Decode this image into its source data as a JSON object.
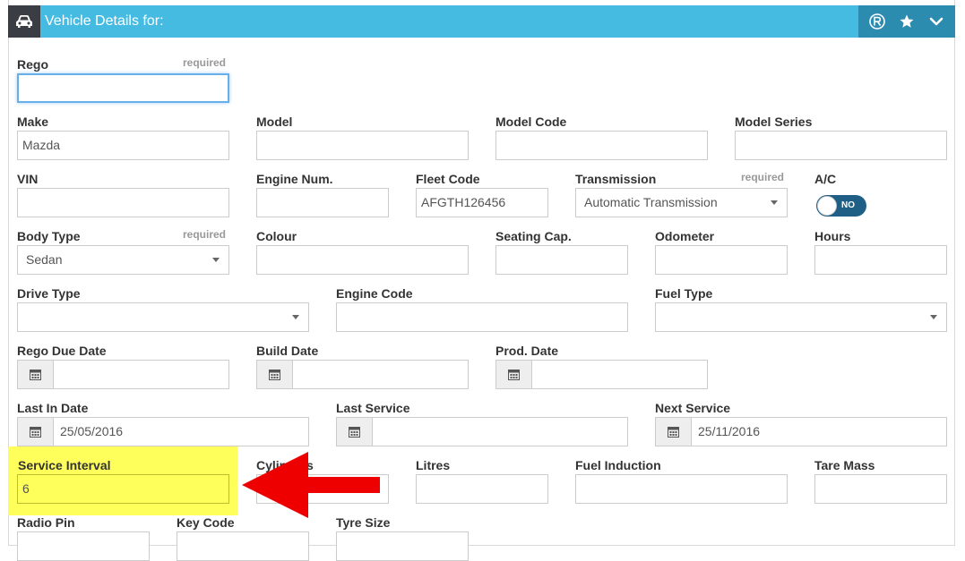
{
  "header": {
    "title": "Vehicle Details for:",
    "icons": [
      "car-icon",
      "r-circle-icon",
      "star-icon",
      "chevron-down-icon"
    ]
  },
  "form": {
    "rego": {
      "label": "Rego",
      "required": "required",
      "value": ""
    },
    "make": {
      "label": "Make",
      "value": "Mazda"
    },
    "model": {
      "label": "Model",
      "value": ""
    },
    "model_code": {
      "label": "Model Code",
      "value": ""
    },
    "model_series": {
      "label": "Model Series",
      "value": ""
    },
    "vin": {
      "label": "VIN",
      "value": ""
    },
    "engine_num": {
      "label": "Engine Num.",
      "value": ""
    },
    "fleet_code": {
      "label": "Fleet Code",
      "value": "AFGTH126456"
    },
    "transmission": {
      "label": "Transmission",
      "required": "required",
      "value": "Automatic Transmission"
    },
    "ac": {
      "label": "A/C",
      "state": "NO"
    },
    "body_type": {
      "label": "Body Type",
      "required": "required",
      "value": "Sedan"
    },
    "colour": {
      "label": "Colour",
      "value": ""
    },
    "seating_cap": {
      "label": "Seating Cap.",
      "value": ""
    },
    "odometer": {
      "label": "Odometer",
      "value": ""
    },
    "hours": {
      "label": "Hours",
      "value": ""
    },
    "drive_type": {
      "label": "Drive Type",
      "value": ""
    },
    "engine_code": {
      "label": "Engine Code",
      "value": ""
    },
    "fuel_type": {
      "label": "Fuel Type",
      "value": ""
    },
    "rego_due_date": {
      "label": "Rego Due Date",
      "value": ""
    },
    "build_date": {
      "label": "Build Date",
      "value": ""
    },
    "prod_date": {
      "label": "Prod. Date",
      "value": ""
    },
    "last_in_date": {
      "label": "Last In Date",
      "value": "25/05/2016"
    },
    "last_service": {
      "label": "Last Service",
      "value": ""
    },
    "next_service": {
      "label": "Next Service",
      "value": "25/11/2016"
    },
    "service_interval": {
      "label": "Service Interval",
      "value": "6"
    },
    "cylinders": {
      "label": "Cylinders",
      "value": ""
    },
    "litres": {
      "label": "Litres",
      "value": ""
    },
    "fuel_induction": {
      "label": "Fuel Induction",
      "value": ""
    },
    "tare_mass": {
      "label": "Tare Mass",
      "value": ""
    },
    "radio_pin": {
      "label": "Radio Pin",
      "value": ""
    },
    "key_code": {
      "label": "Key Code",
      "value": ""
    },
    "tyre_size": {
      "label": "Tyre Size",
      "value": ""
    }
  },
  "colors": {
    "header_bg": "#45bbe2",
    "header_tools_bg": "#2c8cb0",
    "toggle_bg": "#1f5f86",
    "highlight": "#ffff44",
    "arrow": "#ee0000"
  }
}
